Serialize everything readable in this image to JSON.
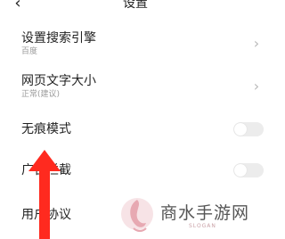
{
  "header": {
    "title": "设置",
    "back_icon": "chevron-left-icon"
  },
  "settings": {
    "search_engine": {
      "label": "设置搜索引擎",
      "value": "百度"
    },
    "font_size": {
      "label": "网页文字大小",
      "value": "正常(建议)"
    },
    "incognito": {
      "label": "无痕模式",
      "enabled": false
    },
    "ad_block": {
      "label": "广告拦截",
      "enabled": false
    },
    "user_agreement": {
      "label": "用户协议"
    }
  },
  "watermark": {
    "text": "商水手游网",
    "slogan": "SLOGAN"
  },
  "colors": {
    "annotation_arrow": "#ff2a1f",
    "toggle_off": "#ececec",
    "secondary_text": "#9a9a9a"
  }
}
